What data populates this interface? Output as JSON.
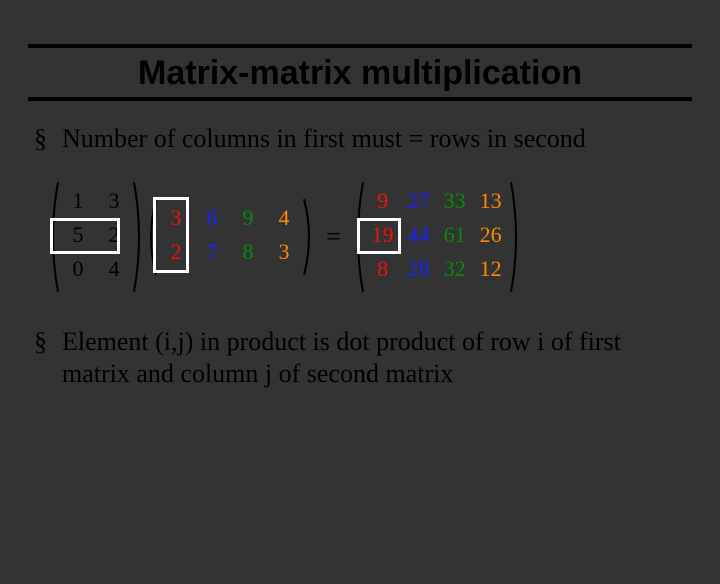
{
  "title": "Matrix-matrix multiplication",
  "bullet1": "Number of columns in first must  = rows in second",
  "bullet2": "Element (i,j) in product is dot product of row i of first matrix and column j of second matrix",
  "eq": "=",
  "matA": {
    "r0": {
      "c0": "1",
      "c1": "3"
    },
    "r1": {
      "c0": "5",
      "c1": "2"
    },
    "r2": {
      "c0": "0",
      "c1": "4"
    }
  },
  "matB": {
    "r0": {
      "c0": "3",
      "c1": "6",
      "c2": "9",
      "c3": "4"
    },
    "r1": {
      "c0": "2",
      "c1": "7",
      "c2": "8",
      "c3": "3"
    }
  },
  "matC": {
    "r0": {
      "c0": "9",
      "c1": "27",
      "c2": "33",
      "c3": "13"
    },
    "r1": {
      "c0": "19",
      "c1": "44",
      "c2": "61",
      "c3": "26"
    },
    "r2": {
      "c0": "8",
      "c1": "28",
      "c2": "32",
      "c3": "12"
    }
  }
}
